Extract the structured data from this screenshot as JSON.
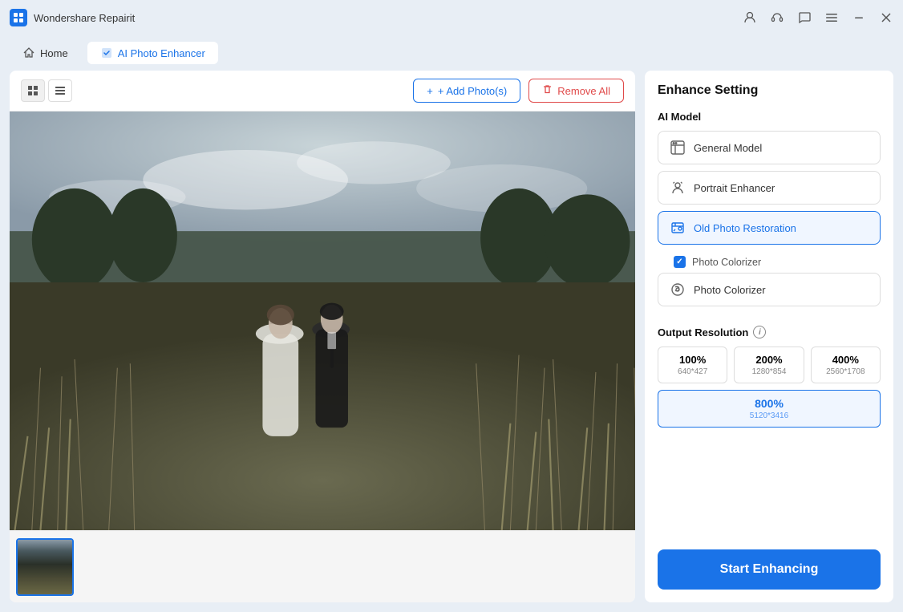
{
  "titlebar": {
    "app_name": "Wondershare Repairit",
    "controls": [
      "user-icon",
      "headset-icon",
      "chat-icon",
      "menu-icon",
      "minimize-icon",
      "close-icon"
    ]
  },
  "navbar": {
    "tabs": [
      {
        "id": "home",
        "label": "Home",
        "icon": "home-icon",
        "active": false
      },
      {
        "id": "ai-photo-enhancer",
        "label": "AI Photo Enhancer",
        "icon": "enhancer-icon",
        "active": true
      }
    ]
  },
  "toolbar": {
    "view_grid_label": "grid-view",
    "view_list_label": "list-view",
    "add_button": "+ Add Photo(s)",
    "remove_button": "Remove All"
  },
  "right_panel": {
    "title": "Enhance Setting",
    "ai_model_label": "AI Model",
    "models": [
      {
        "id": "general",
        "label": "General Model",
        "icon": "image-icon",
        "selected": false
      },
      {
        "id": "portrait",
        "label": "Portrait Enhancer",
        "icon": "portrait-icon",
        "selected": false
      },
      {
        "id": "old-photo",
        "label": "Old Photo Restoration",
        "icon": "restore-icon",
        "selected": true,
        "suboption": {
          "label": "Photo Colorizer",
          "checked": true
        }
      },
      {
        "id": "colorizer",
        "label": "Photo Colorizer",
        "icon": "palette-icon",
        "selected": false
      }
    ],
    "output_resolution_label": "Output Resolution",
    "resolutions": [
      {
        "percent": "100%",
        "dims": "640*427",
        "selected": false
      },
      {
        "percent": "200%",
        "dims": "1280*854",
        "selected": false
      },
      {
        "percent": "400%",
        "dims": "2560*1708",
        "selected": false
      }
    ],
    "selected_resolution": {
      "percent": "800%",
      "dims": "5120*3416",
      "selected": true
    },
    "start_button": "Start Enhancing"
  }
}
